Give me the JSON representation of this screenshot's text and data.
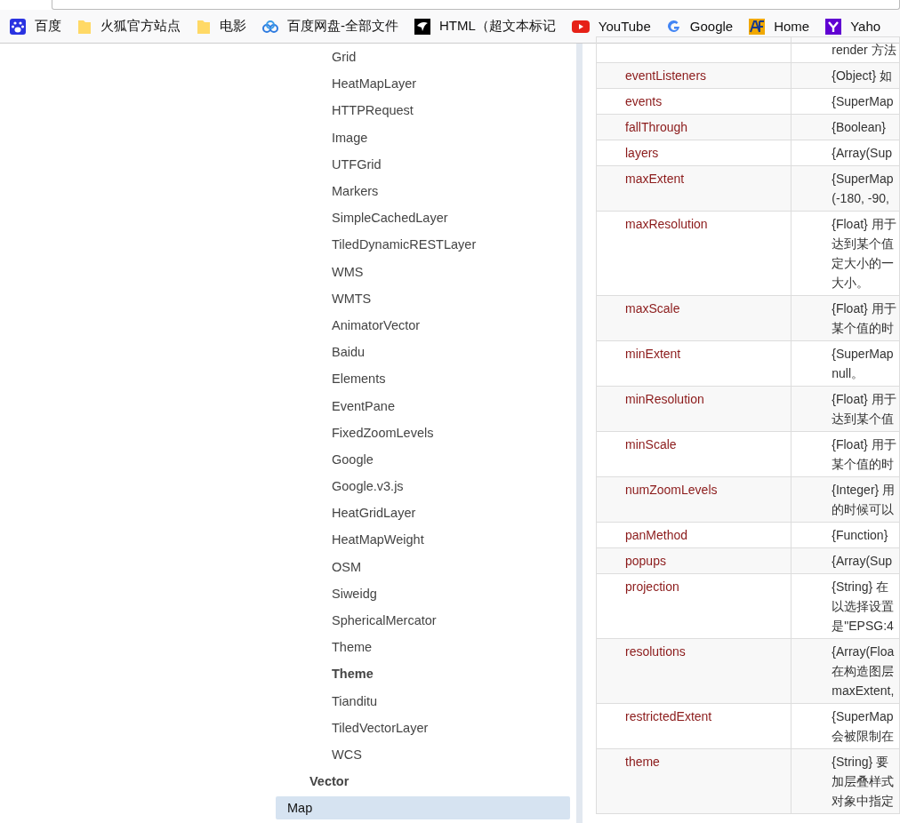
{
  "bookmarks": [
    {
      "label": "百度"
    },
    {
      "label": "火狐官方站点"
    },
    {
      "label": "电影"
    },
    {
      "label": "百度网盘-全部文件"
    },
    {
      "label": "HTML（超文本标记"
    },
    {
      "label": "YouTube"
    },
    {
      "label": "Google"
    },
    {
      "label": "Home"
    },
    {
      "label": "Yaho"
    }
  ],
  "nav": {
    "items": [
      {
        "children": [
          {
            "children": [
              {
                "kind": "file",
                "label": "Grid",
                "selected": false
              },
              {
                "kind": "file",
                "label": "HeatMapLayer",
                "selected": false
              },
              {
                "kind": "file",
                "label": "HTTPRequest",
                "selected": false
              },
              {
                "kind": "file",
                "label": "Image",
                "selected": false
              },
              {
                "kind": "file",
                "label": "UTFGrid",
                "selected": false
              },
              {
                "kind": "file",
                "label": "Markers",
                "selected": false
              },
              {
                "kind": "file",
                "label": "SimpleCachedLayer",
                "selected": false
              },
              {
                "kind": "file",
                "label": "TiledDynamicRESTLayer",
                "selected": false
              },
              {
                "kind": "file",
                "label": "WMS",
                "selected": false
              },
              {
                "kind": "file",
                "label": "WMTS",
                "selected": false
              },
              {
                "kind": "file",
                "label": "AnimatorVector",
                "selected": false
              },
              {
                "kind": "file",
                "label": "Baidu",
                "selected": false
              },
              {
                "kind": "file",
                "label": "Elements",
                "selected": false
              },
              {
                "kind": "file",
                "label": "EventPane",
                "selected": false
              },
              {
                "kind": "file",
                "label": "FixedZoomLevels",
                "selected": false
              },
              {
                "kind": "file",
                "label": "Google",
                "selected": false
              },
              {
                "kind": "file",
                "label": "Google.v3.js",
                "selected": false
              },
              {
                "kind": "file",
                "label": "HeatGridLayer",
                "selected": false
              },
              {
                "kind": "file",
                "label": "HeatMapWeight",
                "selected": false
              },
              {
                "kind": "file",
                "label": "OSM",
                "selected": false
              },
              {
                "kind": "file",
                "label": "Siweidg",
                "selected": false
              },
              {
                "kind": "file",
                "label": "SphericalMercator",
                "selected": false
              },
              {
                "kind": "file",
                "label": "Theme",
                "selected": false
              },
              {
                "kind": "folder",
                "label": "Theme",
                "selected": false
              },
              {
                "kind": "file",
                "label": "Tianditu",
                "selected": false
              },
              {
                "kind": "file",
                "label": "TiledVectorLayer",
                "selected": false
              },
              {
                "kind": "file",
                "label": "WCS",
                "selected": false
              }
            ]
          },
          {
            "kind": "folder",
            "label": "Vector",
            "selected": false
          }
        ]
      },
      {
        "kind": "file",
        "label": "Map",
        "selected": true
      }
    ]
  },
  "table": {
    "rows": [
      {
        "name": "",
        "description": [
          "render 方法"
        ]
      },
      {
        "name": "eventListeners",
        "description": [
          "{Object} 如"
        ]
      },
      {
        "name": "events",
        "description": [
          "{SuperMap"
        ]
      },
      {
        "name": "fallThrough",
        "description": [
          "{Boolean}"
        ]
      },
      {
        "name": "layers",
        "description": [
          "{Array(Sup"
        ]
      },
      {
        "name": "maxExtent",
        "description": [
          "{SuperMap",
          "(-180, -90,"
        ]
      },
      {
        "name": "maxResolution",
        "description": [
          "{Float} 用于",
          "达到某个值",
          "定大小的一",
          "大小。"
        ]
      },
      {
        "name": "maxScale",
        "description": [
          "{Float} 用于",
          "某个值的时"
        ]
      },
      {
        "name": "minExtent",
        "description": [
          "{SuperMap",
          "null。"
        ]
      },
      {
        "name": "minResolution",
        "description": [
          "{Float} 用于",
          "达到某个值"
        ]
      },
      {
        "name": "minScale",
        "description": [
          "{Float} 用于",
          "某个值的时"
        ]
      },
      {
        "name": "numZoomLevels",
        "description": [
          "{Integer} 用",
          "的时候可以"
        ]
      },
      {
        "name": "panMethod",
        "description": [
          "{Function}"
        ]
      },
      {
        "name": "popups",
        "description": [
          "{Array(Sup"
        ]
      },
      {
        "name": "projection",
        "description": [
          "{String} 在",
          "以选择设置",
          "是\"EPSG:4"
        ]
      },
      {
        "name": "resolutions",
        "description": [
          "{Array(Floa",
          "在构造图层",
          "maxExtent,"
        ]
      },
      {
        "name": "restrictedExtent",
        "description": [
          "{SuperMap",
          "会被限制在"
        ]
      },
      {
        "name": "theme",
        "description": [
          "{String} 要",
          "加层叠样式",
          "对象中指定"
        ]
      }
    ]
  }
}
